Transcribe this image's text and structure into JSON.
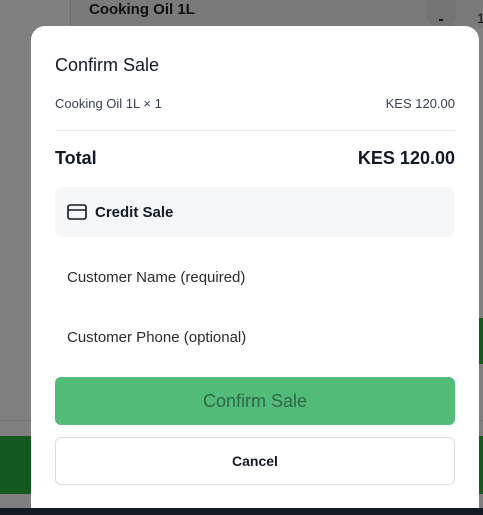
{
  "background": {
    "product_title": "Cooking Oil 1L",
    "qty_minus": "-",
    "qty_count": "1"
  },
  "modal": {
    "title": "Confirm Sale",
    "item": {
      "name": "Cooking Oil 1L × 1",
      "price": "KES 120.00"
    },
    "total": {
      "label": "Total",
      "value": "KES 120.00"
    },
    "payment_method": {
      "icon": "credit-card-icon",
      "label": "Credit Sale"
    },
    "customer_name": {
      "value": "",
      "placeholder": "Customer Name (required)"
    },
    "customer_phone": {
      "value": "",
      "placeholder": "Customer Phone (optional)"
    },
    "confirm_label": "Confirm Sale",
    "cancel_label": "Cancel"
  },
  "colors": {
    "confirm_button": "#52bb78",
    "background_accent": "#16591e",
    "overlay": "#808080"
  }
}
